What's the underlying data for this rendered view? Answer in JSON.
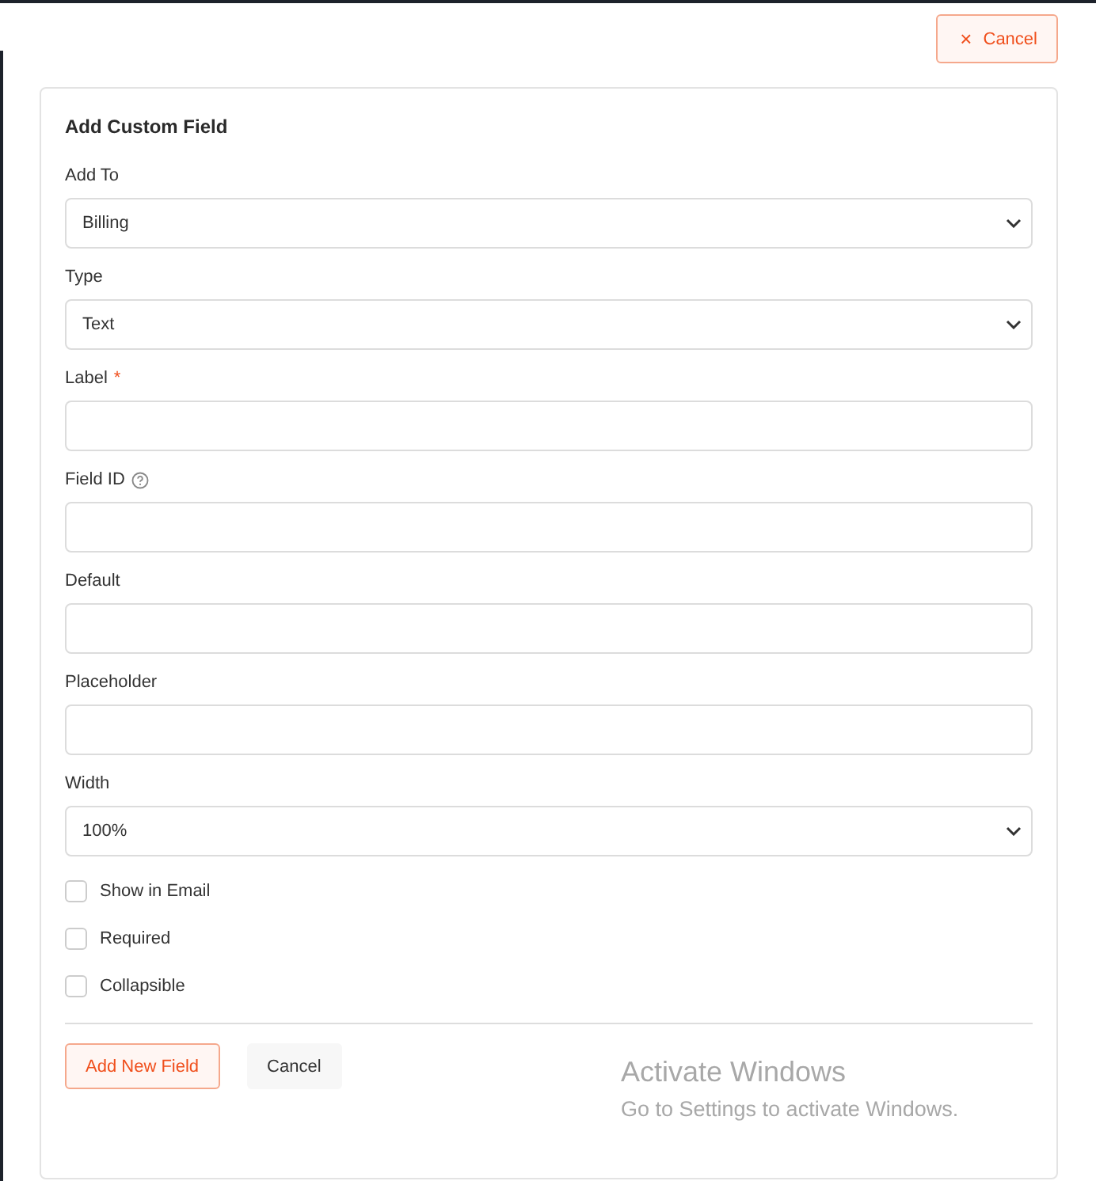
{
  "header": {
    "cancel_button": {
      "icon": "×",
      "label": "Cancel"
    }
  },
  "form": {
    "title": "Add Custom Field",
    "fields": [
      {
        "kind": "select",
        "label": "Add To",
        "value": "Billing",
        "help": false
      },
      {
        "kind": "select",
        "label": "Type",
        "value": "Text",
        "help": false
      },
      {
        "kind": "input",
        "label": "Label",
        "required_mark": "*",
        "help": false
      },
      {
        "kind": "input",
        "label": "Field ID",
        "help": true
      },
      {
        "kind": "input",
        "label": "Default",
        "help": false
      },
      {
        "kind": "input",
        "label": "Placeholder",
        "help": false
      },
      {
        "kind": "select",
        "label": "Width",
        "value": "100%",
        "help": false
      }
    ],
    "checkboxes": [
      {
        "label": "Show in Email",
        "checked": false
      },
      {
        "label": "Required",
        "checked": false
      },
      {
        "label": "Collapsible",
        "checked": false
      }
    ],
    "buttons": [
      {
        "kind": "primary",
        "label": "Add New Field"
      },
      {
        "kind": "secondary",
        "label": "Cancel"
      }
    ]
  },
  "os_notice": {
    "title": "Activate Windows",
    "subtitle": "Go to Settings to activate Windows."
  }
}
